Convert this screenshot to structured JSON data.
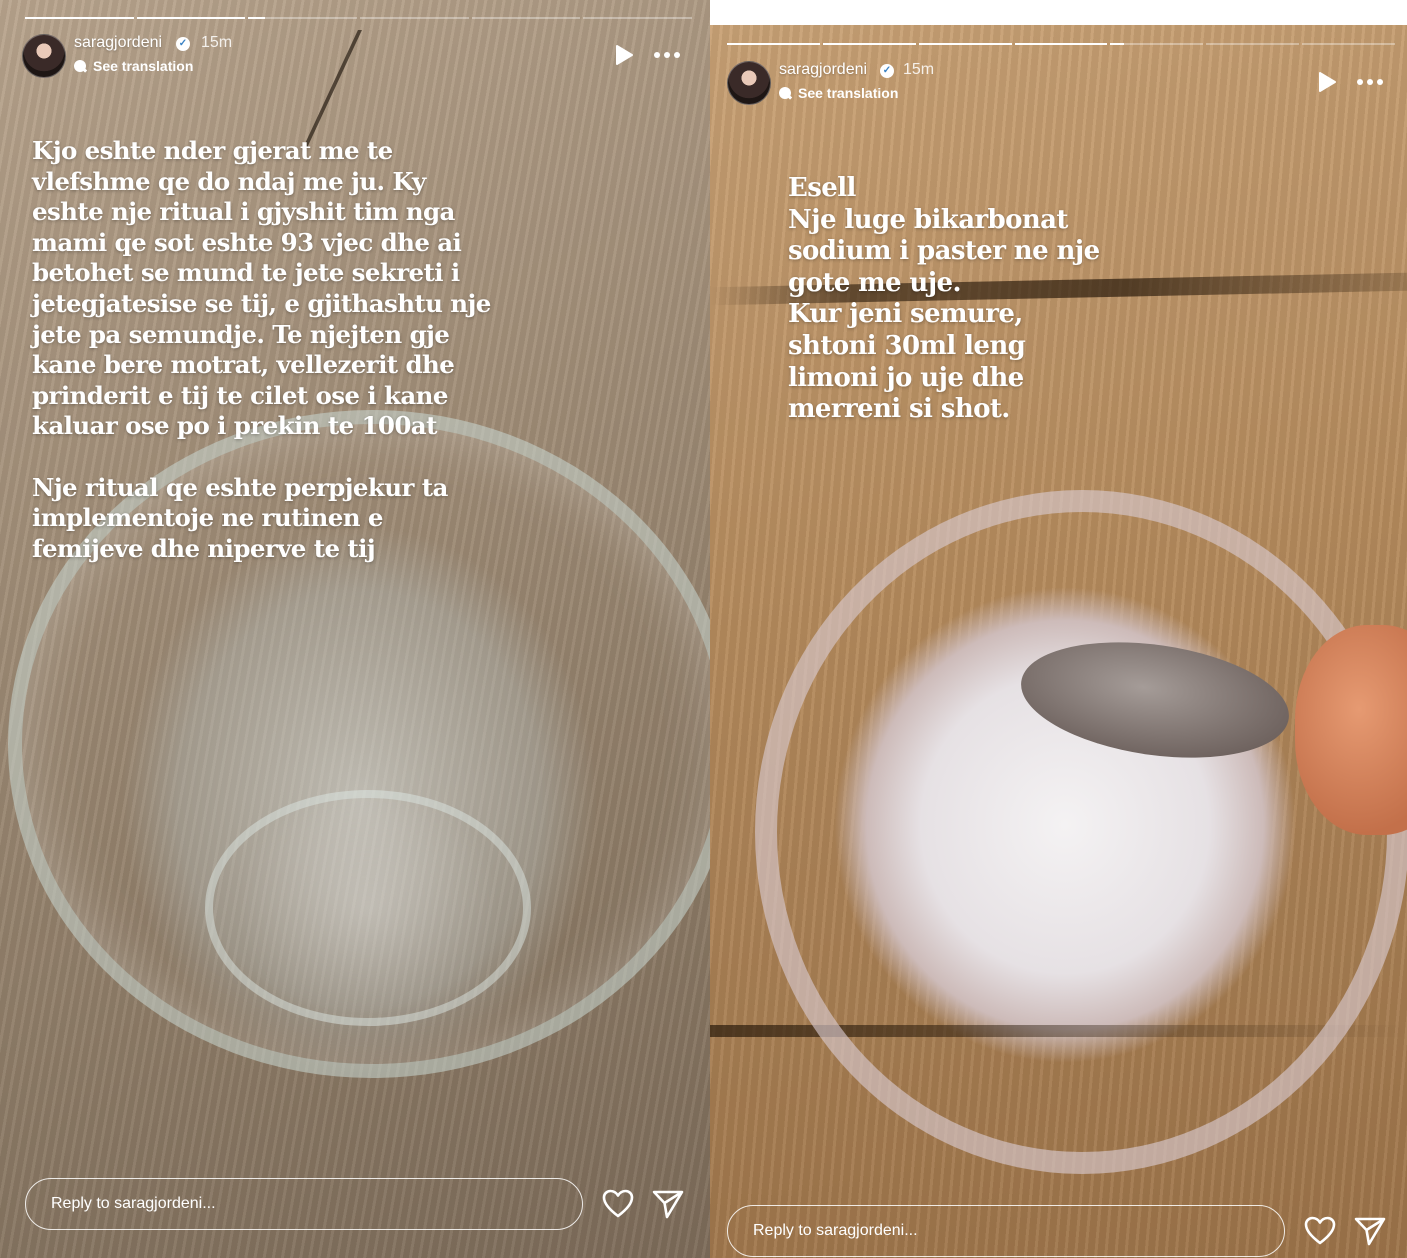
{
  "stories": [
    {
      "id": "left",
      "username": "saragjordeni",
      "verified": true,
      "time": "15m",
      "see_translation": "See translation",
      "caption": "Kjo eshte nder gjerat me te\nvlefshme qe do ndaj me ju. Ky\neshte nje ritual i gjyshit tim nga\nmami qe sot eshte 93 vjec dhe ai\nbetohet se mund te jete sekreti i\njetegjatesise se tij, e gjithashtu nje\njete pa semundje. Te njejten gje\nkane bere motrat, vellezerit dhe\nprinderit e tij te cilet ose i kane\nkaluar ose po i prekin te 100at\n\nNje ritual qe eshte perpjekur ta\nimplementoje ne rutinen e\nfemijeve dhe niperve te tij",
      "reply_placeholder": "Reply to saragjordeni...",
      "progress": [
        1,
        1,
        0.15,
        0,
        0,
        0
      ]
    },
    {
      "id": "right",
      "username": "saragjordeni",
      "verified": true,
      "time": "15m",
      "see_translation": "See translation",
      "caption": "Esell\nNje luge bikarbonat\nsodium i paster ne nje\ngote me uje.\nKur jeni semure,\nshtoni 30ml leng\nlimoni jo uje dhe\nmerreni si shot.",
      "reply_placeholder": "Reply to saragjordeni...",
      "progress": [
        1,
        1,
        1,
        1,
        0.15,
        0,
        0
      ]
    }
  ],
  "icons": {
    "verified": "verified-badge-icon",
    "translate": "translate-icon",
    "play": "play-icon",
    "more": "more-horizontal-icon",
    "like": "heart-icon",
    "share": "send-icon"
  },
  "colors": {
    "verified_blue": "#3b82c4",
    "text": "#ffffff"
  }
}
